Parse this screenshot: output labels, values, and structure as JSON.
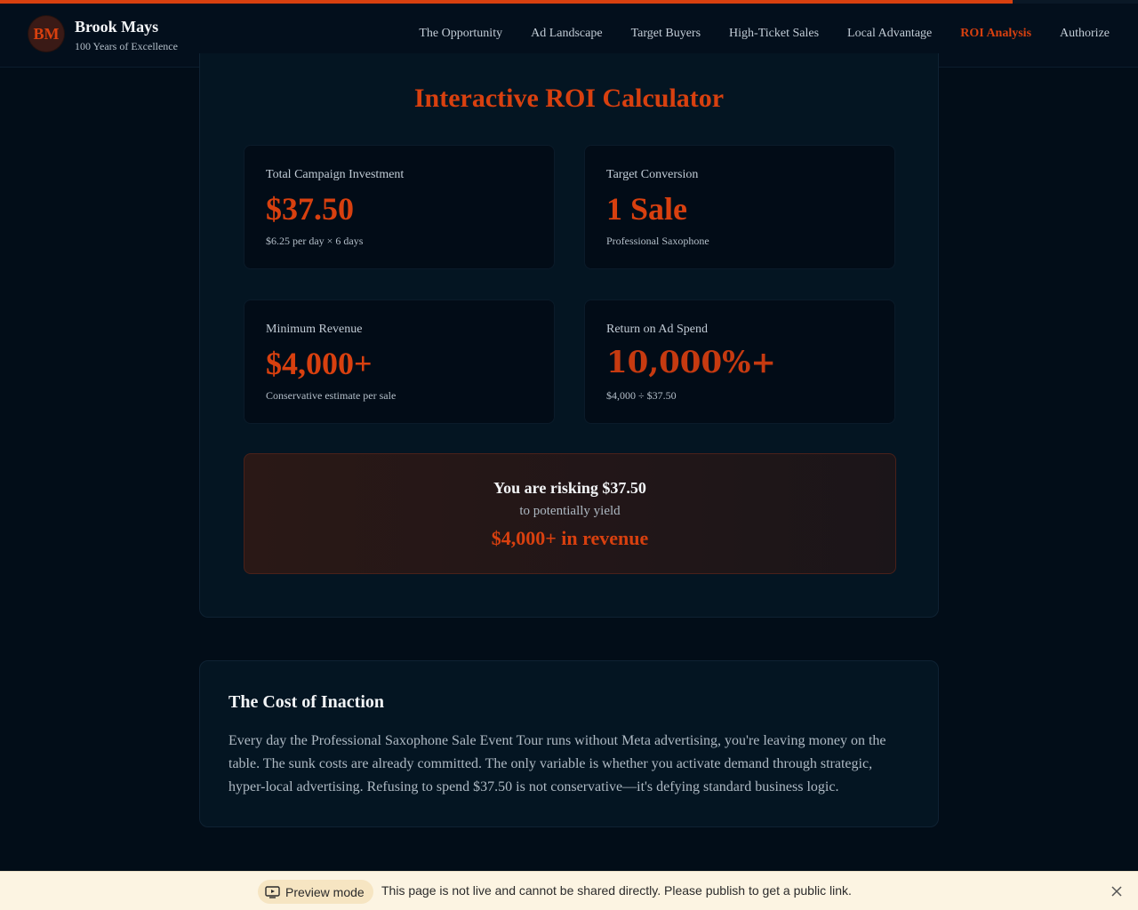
{
  "scroll_progress_percent": 89,
  "brand": {
    "initials": "BM",
    "name": "Brook Mays",
    "tagline": "100 Years of Excellence"
  },
  "nav": {
    "items": [
      {
        "label": "The Opportunity",
        "active": false
      },
      {
        "label": "Ad Landscape",
        "active": false
      },
      {
        "label": "Target Buyers",
        "active": false
      },
      {
        "label": "High-Ticket Sales",
        "active": false
      },
      {
        "label": "Local Advantage",
        "active": false
      },
      {
        "label": "ROI Analysis",
        "active": true
      },
      {
        "label": "Authorize",
        "active": false
      }
    ]
  },
  "calculator": {
    "title": "Interactive ROI Calculator",
    "metrics": [
      {
        "label": "Total Campaign Investment",
        "value": "$37.50",
        "sub": "$6.25 per day × 6 days"
      },
      {
        "label": "Target Conversion",
        "value": "1 Sale",
        "sub": "Professional Saxophone"
      },
      {
        "label": "Minimum Revenue",
        "value": "$4,000+",
        "sub": "Conservative estimate per sale"
      },
      {
        "label": "Return on Ad Spend",
        "value": "10,000%+",
        "sub": "$4,000 ÷ $37.50"
      }
    ],
    "risk": {
      "line1": "You are risking $37.50",
      "line2": "to potentially yield",
      "line3": "$4,000+ in revenue"
    }
  },
  "inaction": {
    "title": "The Cost of Inaction",
    "body": "Every day the Professional Saxophone Sale Event Tour runs without Meta advertising, you're leaving money on the table. The sunk costs are already committed. The only variable is whether you activate demand through strategic, hyper-local advertising. Refusing to spend $37.50 is not conservative—it's defying standard business logic."
  },
  "preview_bar": {
    "badge": "Preview mode",
    "message": "This page is not live and cannot be shared directly. Please publish to get a public link."
  },
  "colors": {
    "accent": "#d8400f",
    "background": "#020d18",
    "card": "#041522"
  }
}
